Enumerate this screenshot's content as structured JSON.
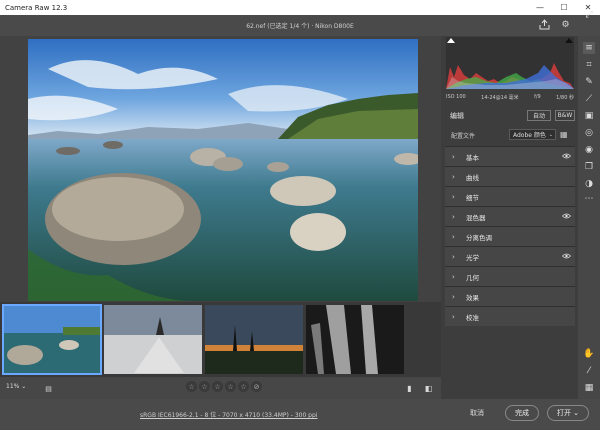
{
  "window": {
    "title": "Camera Raw 12.3"
  },
  "header": {
    "file_info": "62.nef (已选定 1/4 个) · Nikon D800E"
  },
  "histogram": {
    "exif": [
      "ISO 100",
      "14-24@14 毫米",
      "f/9",
      "1/80 秒"
    ]
  },
  "edit": {
    "title": "编辑",
    "auto_label": "自动",
    "bw_label": "B&W",
    "profile_label": "配置文件",
    "profile_value": "Adobe 颜色"
  },
  "sections": [
    {
      "label": "基本",
      "eye": true
    },
    {
      "label": "曲线",
      "eye": false
    },
    {
      "label": "细节",
      "eye": false
    },
    {
      "label": "混色器",
      "eye": true
    },
    {
      "label": "分离色调",
      "eye": false
    },
    {
      "label": "光学",
      "eye": true
    },
    {
      "label": "几何",
      "eye": false
    },
    {
      "label": "效果",
      "eye": false
    },
    {
      "label": "校准",
      "eye": false
    }
  ],
  "bottom": {
    "zoom": "11%",
    "stars": [
      "☆",
      "☆",
      "☆",
      "☆",
      "☆"
    ]
  },
  "footer": {
    "workflow": "sRGB IEC61966-2.1 - 8 位 - 7070 x 4710 (33.4MP) - 300 ppi",
    "cancel": "取消",
    "done": "完成",
    "open": "打开"
  },
  "accent_color": "#6aa9ff"
}
